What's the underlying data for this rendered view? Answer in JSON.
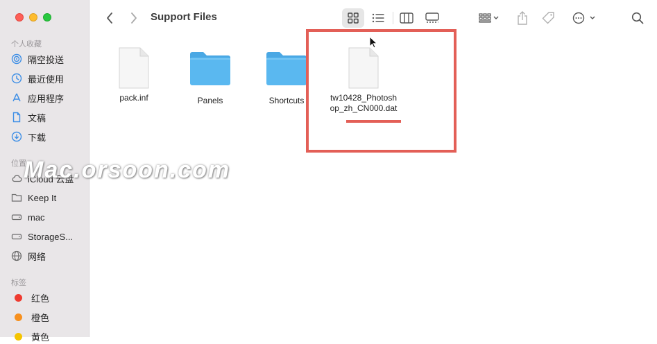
{
  "window": {
    "title": "Support Files"
  },
  "sidebar": {
    "favorites_title": "个人收藏",
    "favorites": [
      {
        "label": "隔空投送",
        "icon": "airdrop-icon"
      },
      {
        "label": "最近使用",
        "icon": "clock-icon"
      },
      {
        "label": "应用程序",
        "icon": "applications-icon"
      },
      {
        "label": "文稿",
        "icon": "document-icon"
      },
      {
        "label": "下载",
        "icon": "download-icon"
      }
    ],
    "locations_title": "位置",
    "locations": [
      {
        "label": "iCloud 云盘",
        "icon": "cloud-icon"
      },
      {
        "label": "Keep It",
        "icon": "folder-icon"
      },
      {
        "label": "mac",
        "icon": "disk-icon"
      },
      {
        "label": "StorageS...",
        "icon": "disk-icon"
      },
      {
        "label": "网络",
        "icon": "network-icon"
      }
    ],
    "tags_title": "标签",
    "tags": [
      {
        "label": "红色",
        "color": "#ef3b30"
      },
      {
        "label": "橙色",
        "color": "#f7901e"
      },
      {
        "label": "黄色",
        "color": "#f5c400"
      }
    ]
  },
  "files": [
    {
      "name": "pack.inf",
      "kind": "document"
    },
    {
      "name": "Panels",
      "kind": "folder"
    },
    {
      "name": "Shortcuts",
      "kind": "folder"
    },
    {
      "name": "tw10428_Photoshop_zh_CN000.dat",
      "line1": "tw10428_Photosh",
      "line2": "op_zh_CN000.dat",
      "kind": "document"
    }
  ],
  "watermark": "Mac.orsoon.com",
  "colors": {
    "folder": "#5ab8f0",
    "folder_tab": "#4aa8e4",
    "highlight": "#e35f57"
  }
}
